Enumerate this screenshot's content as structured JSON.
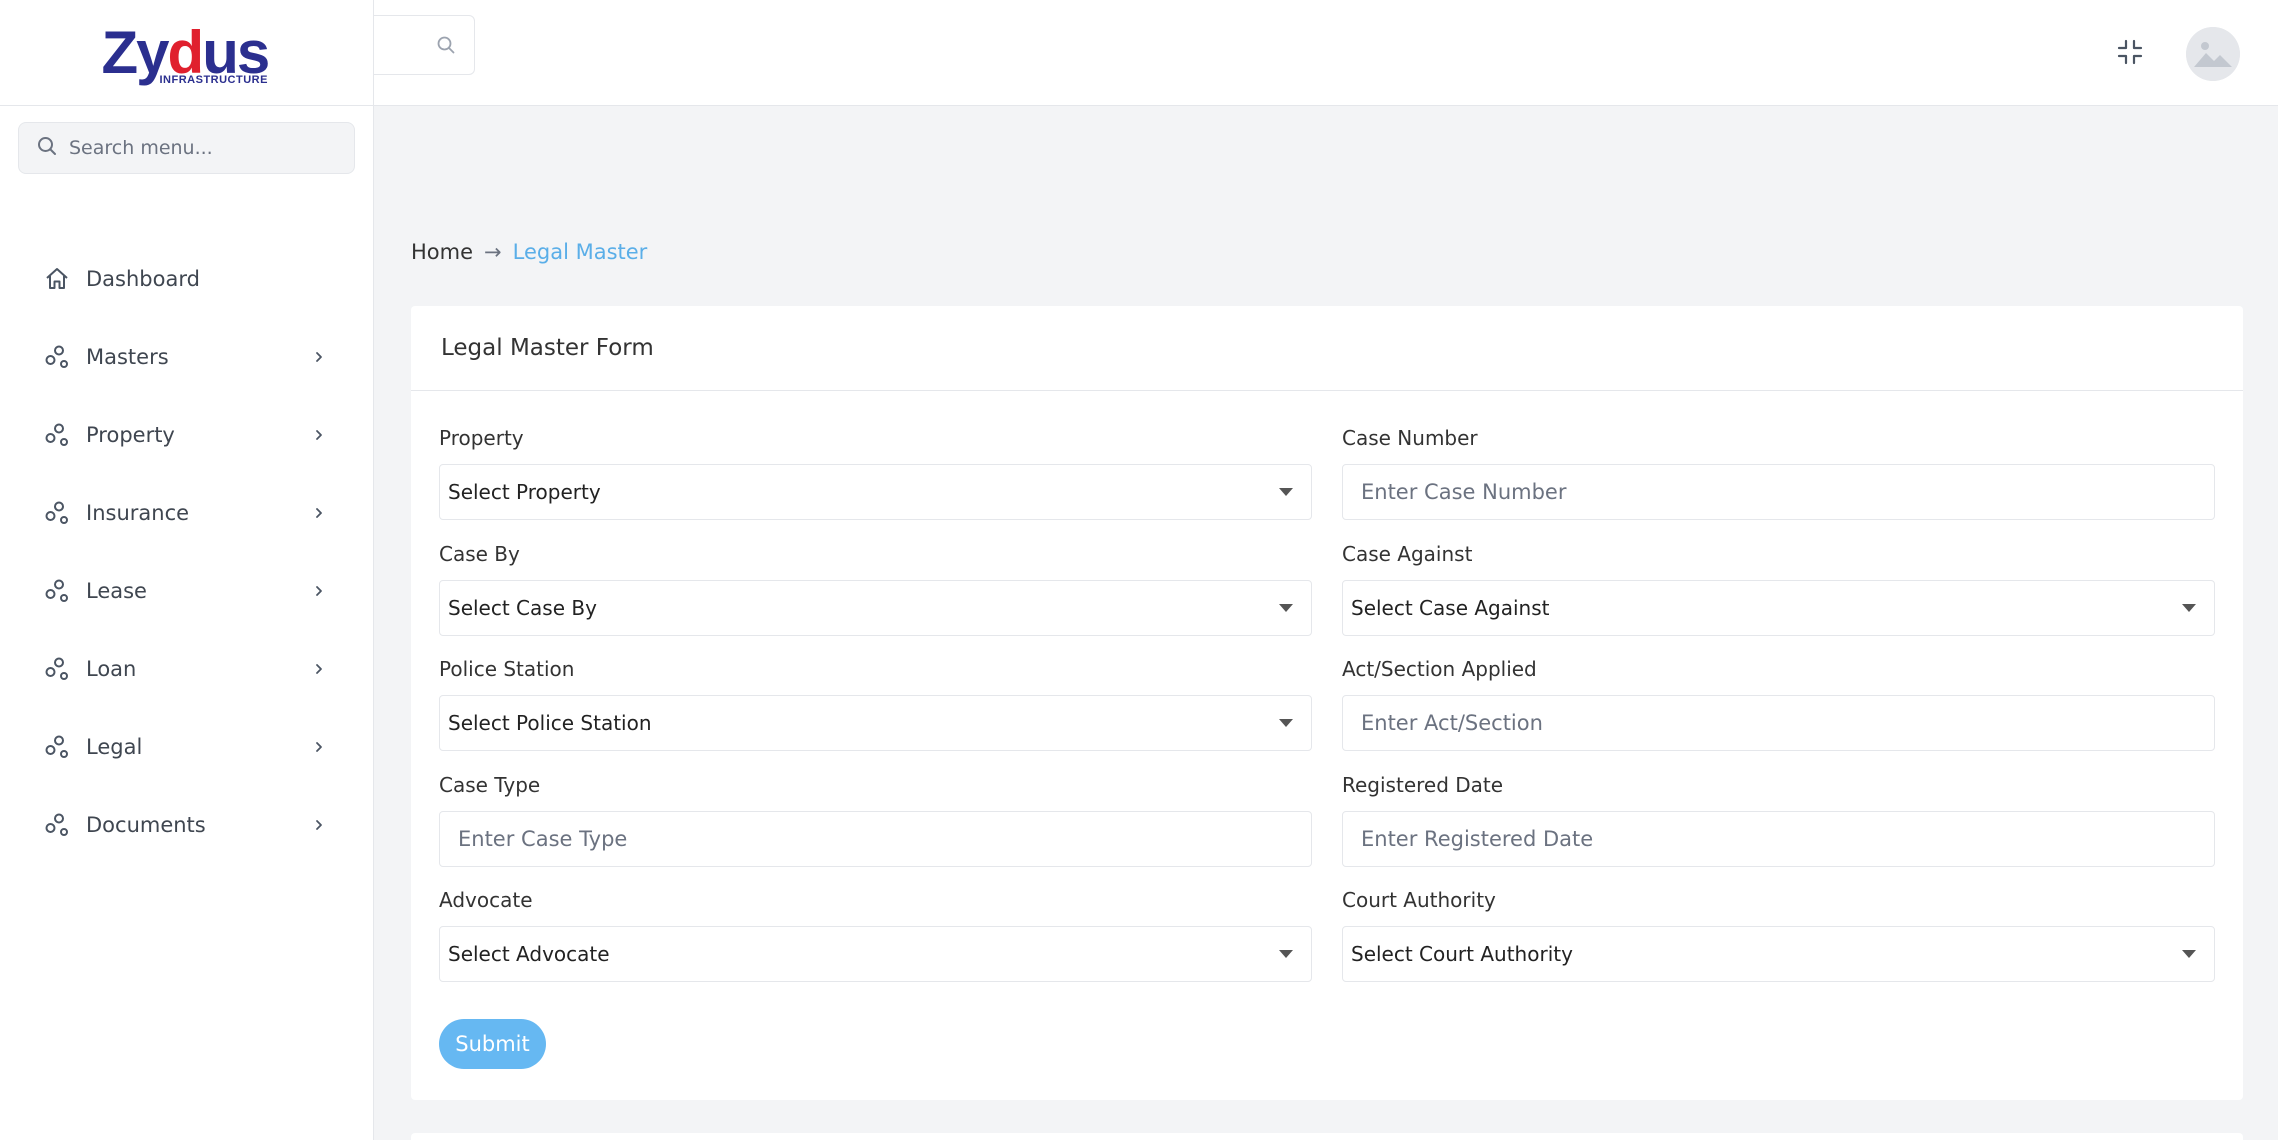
{
  "brand": {
    "name_part1": "Zy",
    "name_part2": "d",
    "name_part3": "us",
    "subtitle": "INFRASTRUCTURE",
    "primary_color": "#2b2f8f",
    "accent_color": "#e0202e"
  },
  "sidebar": {
    "search_placeholder": "Search menu...",
    "items": [
      {
        "label": "Dashboard",
        "icon": "home-icon",
        "has_children": false
      },
      {
        "label": "Masters",
        "icon": "circles-icon",
        "has_children": true
      },
      {
        "label": "Property",
        "icon": "circles-icon",
        "has_children": true
      },
      {
        "label": "Insurance",
        "icon": "circles-icon",
        "has_children": true
      },
      {
        "label": "Lease",
        "icon": "circles-icon",
        "has_children": true
      },
      {
        "label": "Loan",
        "icon": "circles-icon",
        "has_children": true
      },
      {
        "label": "Legal",
        "icon": "circles-icon",
        "has_children": true
      },
      {
        "label": "Documents",
        "icon": "circles-icon",
        "has_children": true
      }
    ]
  },
  "topbar": {
    "search_icon": "search-icon",
    "collapse_icon": "collapse-icon",
    "avatar_icon": "avatar-placeholder-icon"
  },
  "breadcrumb": {
    "home": "Home",
    "separator": "→",
    "current": "Legal Master",
    "current_color": "#5aaee8"
  },
  "form": {
    "title": "Legal Master Form",
    "fields": {
      "property": {
        "label": "Property",
        "type": "select",
        "value": "Select Property"
      },
      "case_number": {
        "label": "Case Number",
        "type": "input",
        "placeholder": "Enter Case Number"
      },
      "case_by": {
        "label": "Case By",
        "type": "select",
        "value": "Select Case By"
      },
      "case_against": {
        "label": "Case Against",
        "type": "select",
        "value": "Select Case Against"
      },
      "police_station": {
        "label": "Police Station",
        "type": "select",
        "value": "Select Police Station"
      },
      "act_section": {
        "label": "Act/Section Applied",
        "type": "input",
        "placeholder": "Enter Act/Section"
      },
      "case_type": {
        "label": "Case Type",
        "type": "input",
        "placeholder": "Enter Case Type"
      },
      "registered_date": {
        "label": "Registered Date",
        "type": "input",
        "placeholder": "Enter Registered Date"
      },
      "advocate": {
        "label": "Advocate",
        "type": "select",
        "value": "Select Advocate"
      },
      "court_authority": {
        "label": "Court Authority",
        "type": "select",
        "value": "Select Court Authority"
      }
    },
    "submit_label": "Submit",
    "submit_color": "#66b8f2"
  }
}
